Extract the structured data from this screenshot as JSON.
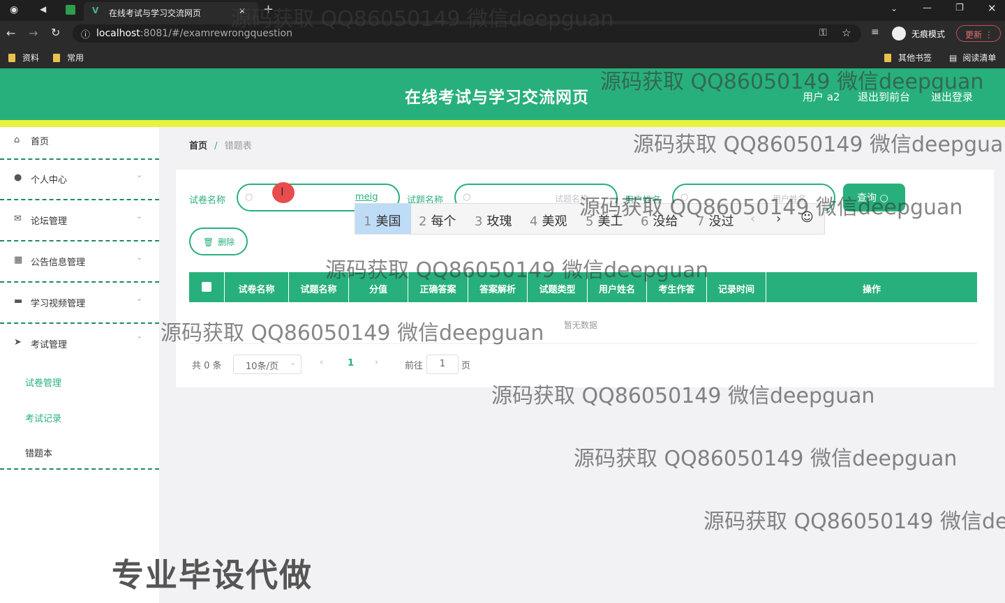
{
  "browser": {
    "tab_title": "在线考试与学习交流网页",
    "url_host": "localhost",
    "url_rest": ":8081/#/examrewrongquestion",
    "incognito_label": "无痕模式",
    "update_label": "更新",
    "bookmarks": [
      "资料",
      "常用"
    ],
    "other_bookmarks": "其他书签",
    "reading_list": "阅读清单"
  },
  "header": {
    "title": "在线考试与学习交流网页",
    "user": "用户 a2",
    "to_front": "退出到前台",
    "logout": "退出登录"
  },
  "sidebar": {
    "items": [
      {
        "label": "首页",
        "icon": "home-icon"
      },
      {
        "label": "个人中心",
        "icon": "user-icon"
      },
      {
        "label": "论坛管理",
        "icon": "mail-icon"
      },
      {
        "label": "公告信息管理",
        "icon": "grid-icon"
      },
      {
        "label": "学习视频管理",
        "icon": "briefcase-icon"
      },
      {
        "label": "考试管理",
        "icon": "send-icon"
      }
    ],
    "subitems": [
      "试卷管理",
      "考试记录",
      "错题本"
    ]
  },
  "breadcrumb": {
    "home": "首页",
    "sep": "/",
    "current": "错题表"
  },
  "filters": {
    "paper_label": "试卷名称",
    "paper_value": "meig",
    "question_label": "试题名称",
    "question_placeholder": "试题名称",
    "user_label": "用户姓名",
    "user_placeholder": "用户姓名",
    "search_label": "查询"
  },
  "delete_label": "删除",
  "table": {
    "headers": [
      "试卷名称",
      "试题名称",
      "分值",
      "正确答案",
      "答案解析",
      "试题类型",
      "用户姓名",
      "考生作答",
      "记录时间",
      "操作"
    ],
    "empty_text": "暂无数据"
  },
  "pager": {
    "total": "共 0 条",
    "page_size": "10条/页",
    "current": "1",
    "goto": "前往",
    "goto_value": "1",
    "page_unit": "页"
  },
  "ime": {
    "candidates": [
      {
        "n": "1",
        "w": "美国"
      },
      {
        "n": "2",
        "w": "每个"
      },
      {
        "n": "3",
        "w": "玫瑰"
      },
      {
        "n": "4",
        "w": "美观"
      },
      {
        "n": "5",
        "w": "美工"
      },
      {
        "n": "6",
        "w": "没给"
      },
      {
        "n": "7",
        "w": "没过"
      }
    ]
  },
  "watermark": "源码获取 QQ86050149 微信deepguan",
  "watermark_tail": "源码获取 QQ86050149 微信dee",
  "promo": "专业毕设代做",
  "colors": {
    "primary": "#27b07b",
    "accent_bar": "#e8f23a",
    "divider": "#1c8b5e"
  }
}
